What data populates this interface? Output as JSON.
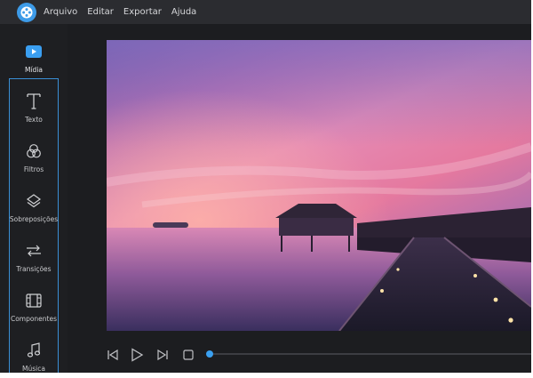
{
  "menu": {
    "items": [
      "Arquivo",
      "Editar",
      "Exportar",
      "Ajuda"
    ]
  },
  "sidebar": {
    "items": [
      {
        "label": "Mídia",
        "icon": "media-play-icon",
        "active": true
      },
      {
        "label": "Texto",
        "icon": "text-icon"
      },
      {
        "label": "Filtros",
        "icon": "filters-icon"
      },
      {
        "label": "Sobreposições",
        "icon": "overlays-icon"
      },
      {
        "label": "Transições",
        "icon": "transitions-icon"
      },
      {
        "label": "Componentes",
        "icon": "components-icon"
      },
      {
        "label": "Música",
        "icon": "music-icon"
      }
    ]
  },
  "playback": {
    "progress": 0
  },
  "colors": {
    "accent": "#3a9ef0",
    "background": "#1c1d20",
    "menubar": "#2b2c30"
  }
}
